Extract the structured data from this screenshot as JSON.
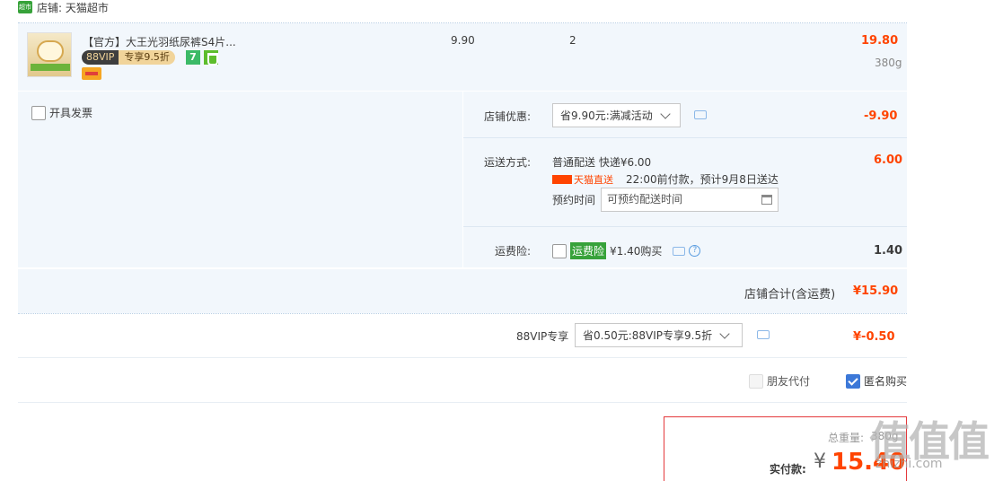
{
  "shop": {
    "logo_text": "超市",
    "name": "店铺: 天猫超市"
  },
  "item": {
    "title": "【官方】大王光羽纸尿裤S4片...",
    "badge_88vip": "88VIP",
    "badge_discount": "专享9.5折",
    "icon_7": "7",
    "unit_price": "9.90",
    "quantity": "2",
    "subtotal": "19.80",
    "weight": "380g"
  },
  "invoice": {
    "label": "开具发票"
  },
  "shop_discount": {
    "label": "店铺优惠:",
    "selected": "省9.90元:满减活动",
    "amount": "-9.90"
  },
  "shipping": {
    "label": "运送方式:",
    "method": "普通配送 快递¥6.00",
    "tmall_tag": "天猫直送",
    "notice": "22:00前付款，预计9月8日送达",
    "reserve_label": "预约时间",
    "reserve_placeholder": "可预约配送时间",
    "amount": "6.00"
  },
  "insurance": {
    "label": "运费险:",
    "badge": "运费险",
    "price": "¥1.40购买",
    "help": "?",
    "amount": "1.40"
  },
  "shop_total": {
    "label": "店铺合计(含运费)",
    "amount": "¥15.90"
  },
  "vip_discount": {
    "label": "88VIP专享",
    "selected": "省0.50元:88VIP专享9.5折",
    "amount": "¥-0.50"
  },
  "options": {
    "friend_pay": "朋友代付",
    "anonymous": "匿名购买"
  },
  "payment": {
    "weight_label": "总重量:",
    "weight_value": "380g",
    "pay_label": "实付款:",
    "currency": "¥",
    "amount": "15.40"
  },
  "watermark": {
    "glyphs": "值值值",
    "site": "zhizhi.com"
  }
}
